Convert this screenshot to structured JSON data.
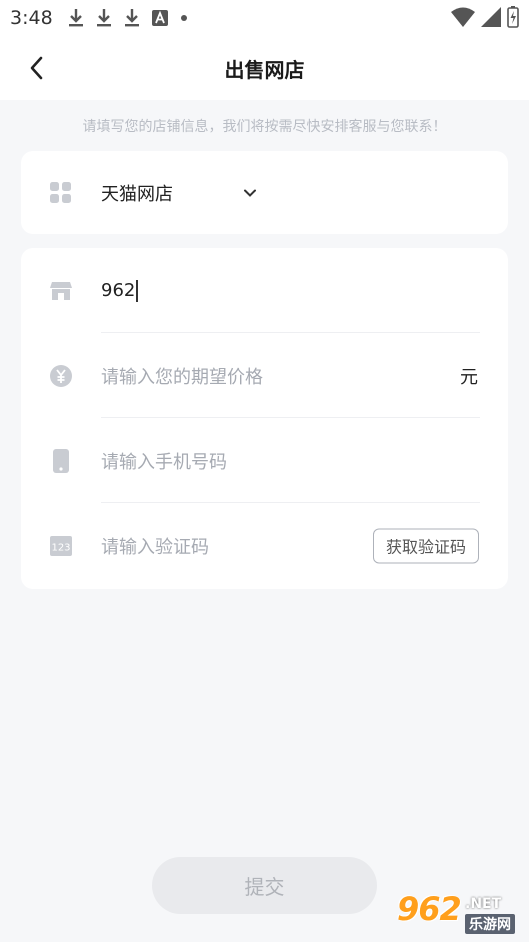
{
  "status_bar": {
    "time": "3:48",
    "icons_left": [
      "download-icon",
      "download-icon",
      "download-icon",
      "font-icon",
      "dot-icon"
    ],
    "icons_right": [
      "wifi-icon",
      "signal-icon",
      "battery-icon"
    ]
  },
  "header": {
    "title": "出售网店",
    "back_icon": "back-arrow-icon"
  },
  "hint": "请填写您的店铺信息，我们将按需尽快安排客服与您联系！",
  "platform": {
    "icon": "grid-icon",
    "value": "天猫网店",
    "dropdown_icon": "chevron-down-icon"
  },
  "form": {
    "shop_name": {
      "icon": "store-icon",
      "value": "962"
    },
    "price": {
      "icon": "yen-icon",
      "placeholder": "请输入您的期望价格",
      "unit": "元"
    },
    "phone": {
      "icon": "phone-icon",
      "placeholder": "请输入手机号码"
    },
    "code": {
      "icon": "keypad-icon",
      "placeholder": "请输入验证码",
      "button_label": "获取验证码"
    }
  },
  "submit_label": "提交",
  "watermark": {
    "number": "962",
    "net": ".NET",
    "cn": "乐游网"
  },
  "colors": {
    "background": "#f6f7f9",
    "icon_gray": "#c9ccd2",
    "placeholder": "#a6aab2",
    "submit_bg": "#e9eaed"
  }
}
